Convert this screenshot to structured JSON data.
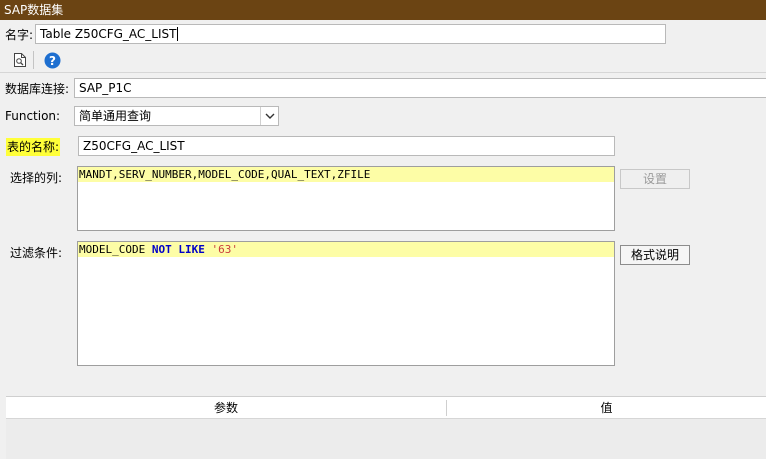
{
  "window": {
    "title": "SAP数据集"
  },
  "name_row": {
    "label": "名字:",
    "value": "Table Z50CFG_AC_LIST"
  },
  "toolbar": {
    "preview_icon": "page-preview-icon",
    "help_icon": "help-circle-icon",
    "help_glyph": "?"
  },
  "connection": {
    "label": "数据库连接:",
    "value": "SAP_P1C"
  },
  "function": {
    "label": "Function:",
    "value": "简单通用查询",
    "arrow_icon": "chevron-down-icon"
  },
  "table_name": {
    "label": "表的名称:",
    "value": "Z50CFG_AC_LIST"
  },
  "columns": {
    "label": "选择的列:",
    "value": "MANDT,SERV_NUMBER,MODEL_CODE,QUAL_TEXT,ZFILE",
    "settings_button": "设置"
  },
  "filter": {
    "label": "过滤条件:",
    "tokens": {
      "t1": "MODEL_CODE ",
      "t2": "NOT",
      "t3": " ",
      "t4": "LIKE",
      "t5": " ",
      "t6": "'63'"
    },
    "format_button": "格式说明"
  },
  "params_table": {
    "columns": [
      "参数",
      "值"
    ]
  },
  "colors": {
    "titlebar": "#6b4413",
    "highlight": "#ffff39",
    "line_highlight": "#fdfda6",
    "keyword": "#0000c8",
    "string": "#c83c3c",
    "help": "#1e6fd0"
  }
}
